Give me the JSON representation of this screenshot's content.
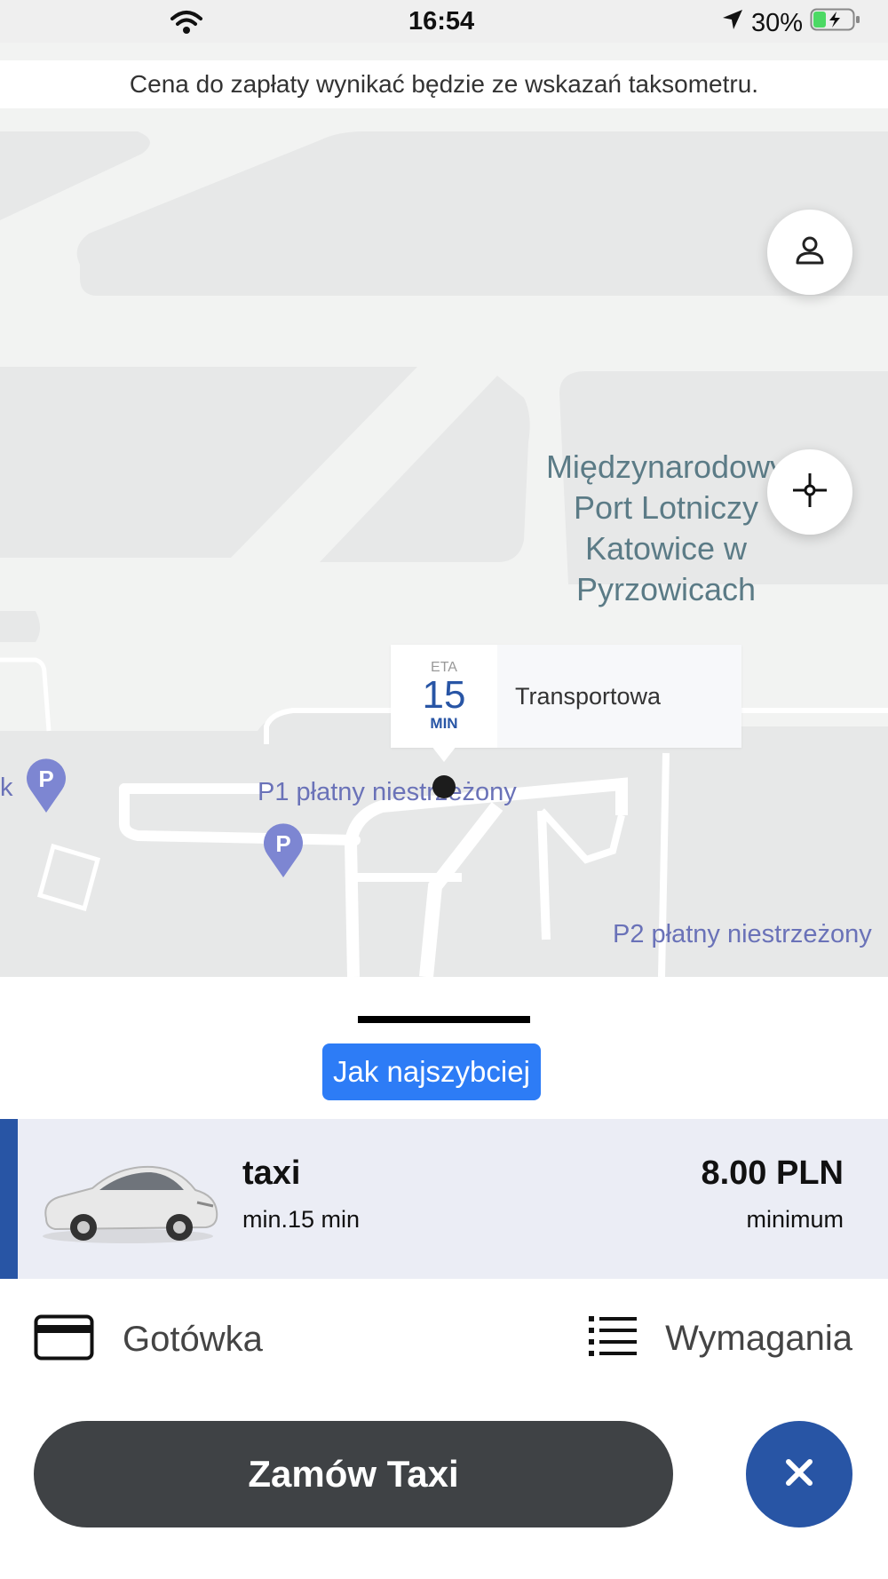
{
  "status_bar": {
    "time": "16:54",
    "battery": "30%",
    "icons": [
      "wifi-icon",
      "location-arrow-icon",
      "battery-charging-icon"
    ]
  },
  "map": {
    "notice": "Cena do zapłaty wynikać będzie ze wskazań taksometru.",
    "airport_label": [
      "Międzynarodowy",
      "Port Lotniczy",
      "Katowice w",
      "Pyrzowicach"
    ],
    "eta": {
      "label": "ETA",
      "value": "15",
      "unit": "MIN",
      "street": "Transportowa"
    },
    "parking_labels": [
      "P1 płatny niestrzeżony",
      "P2 płatny niestrzeżony",
      "k"
    ],
    "buttons": [
      "profile-icon",
      "locate-icon"
    ]
  },
  "sheet": {
    "time_option": "Jak najszybciej",
    "service": {
      "name": "taxi",
      "eta": "min.15 min",
      "price": "8.00 PLN",
      "price_note": "minimum"
    },
    "payment_label": "Gotówka",
    "requirements_label": "Wymagania",
    "order_button": "Zamów Taxi"
  },
  "colors": {
    "accent": "#2855a5",
    "asap_button": "#2d7cf6",
    "order_button": "#3f4245",
    "service_bg": "#ebedf5",
    "map_bg": "#f2f3f2"
  }
}
